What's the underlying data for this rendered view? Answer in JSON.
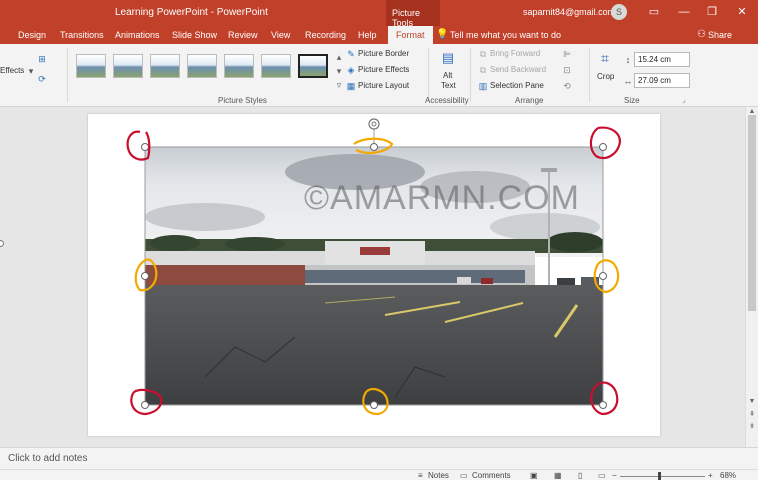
{
  "window": {
    "title": "Learning PowerPoint - PowerPoint",
    "contextual_tab": "Picture Tools",
    "user_email": "saparnit84@gmail.com",
    "avatar_initial": "S"
  },
  "menu": {
    "tabs": [
      "Design",
      "Transitions",
      "Animations",
      "Slide Show",
      "Review",
      "View",
      "Recording",
      "Help"
    ],
    "active_tab": "Format",
    "tell_me": "Tell me what you want to do",
    "share": "Share"
  },
  "ribbon": {
    "effects_label": "Effects",
    "picture_border": "Picture Border",
    "picture_effects": "Picture Effects",
    "picture_layout": "Picture Layout",
    "picture_styles_group": "Picture Styles",
    "alt_text_1": "Alt",
    "alt_text_2": "Text",
    "accessibility_group": "Accessibility",
    "bring_forward": "Bring Forward",
    "send_backward": "Send Backward",
    "selection_pane": "Selection Pane",
    "arrange_group": "Arrange",
    "crop": "Crop",
    "height_value": "15.24 cm",
    "width_value": "27.09 cm",
    "size_group": "Size"
  },
  "slide": {
    "watermark": "©AMARMN.COM"
  },
  "notes": {
    "placeholder": "Click to add notes"
  },
  "status": {
    "notes": "Notes",
    "comments": "Comments",
    "zoom": "68%"
  },
  "colors": {
    "accent": "#c0402a",
    "handle_red": "#c8102e",
    "handle_yellow": "#f2a900"
  }
}
